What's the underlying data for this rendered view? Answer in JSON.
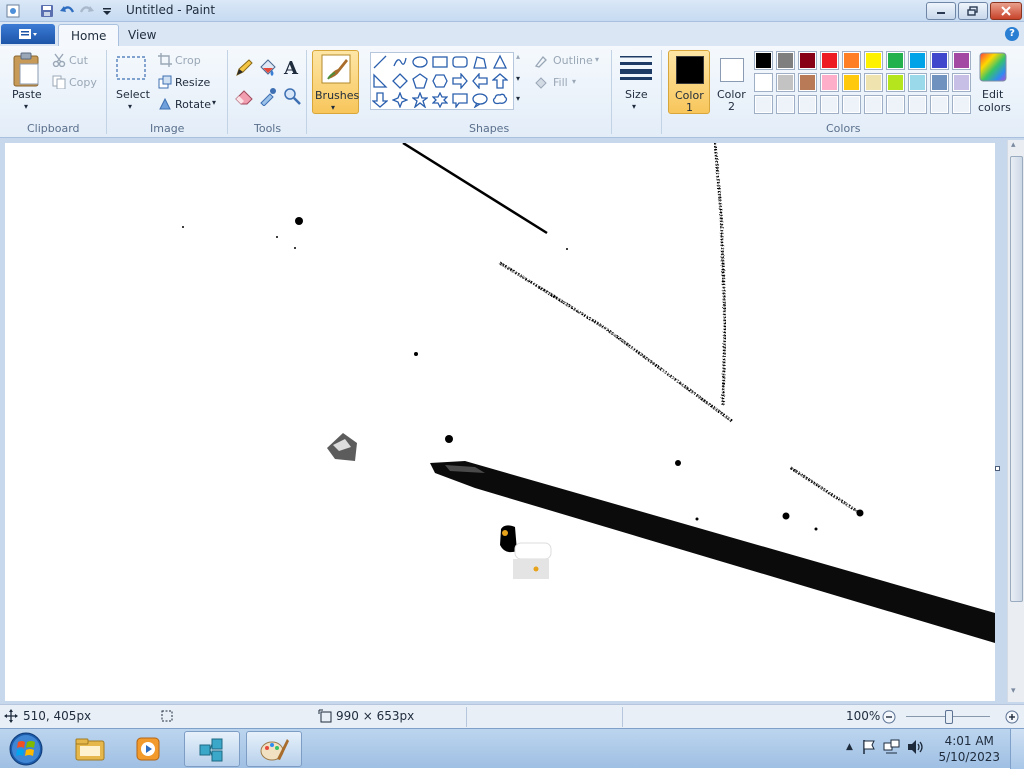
{
  "window": {
    "title": "Untitled - Paint"
  },
  "tabs": {
    "home": "Home",
    "view": "View"
  },
  "clipboard": {
    "paste": "Paste",
    "cut": "Cut",
    "copy": "Copy",
    "group": "Clipboard"
  },
  "image": {
    "select": "Select",
    "crop": "Crop",
    "resize": "Resize",
    "rotate": "Rotate",
    "group": "Image"
  },
  "tools": {
    "group": "Tools"
  },
  "brushes": {
    "label": "Brushes"
  },
  "shapes": {
    "outline": "Outline",
    "fill": "Fill",
    "group": "Shapes"
  },
  "size": {
    "label": "Size"
  },
  "colors": {
    "color1_line1": "Color",
    "color1_line2": "1",
    "color1_value": "#000000",
    "color2_line1": "Color",
    "color2_line2": "2",
    "color2_value": "#ffffff",
    "edit_line1": "Edit",
    "edit_line2": "colors",
    "group": "Colors",
    "palette_row1": [
      "#000000",
      "#7f7f7f",
      "#880015",
      "#ed1c24",
      "#ff7f27",
      "#fff200",
      "#22b14c",
      "#00a2e8",
      "#3f48cc",
      "#a349a4"
    ],
    "palette_row2": [
      "#ffffff",
      "#c3c3c3",
      "#b97a57",
      "#ffaec9",
      "#ffc90e",
      "#efe4b0",
      "#b5e61d",
      "#99d9ea",
      "#7092be",
      "#c8bfe7"
    ]
  },
  "status": {
    "cursor_pos": "510, 405px",
    "canvas_size": "990 × 653px",
    "zoom": "100%"
  },
  "taskbar": {
    "time": "4:01 AM",
    "date": "5/10/2023"
  },
  "icons": [
    "app-icon",
    "save-icon",
    "undo-icon",
    "redo-icon",
    "customize-icon",
    "help-icon",
    "paste-icon",
    "cut-icon",
    "copy-icon",
    "select-icon",
    "crop-icon",
    "resize-icon",
    "rotate-icon",
    "pencil-icon",
    "fill-icon",
    "text-icon",
    "eraser-icon",
    "color-picker-icon",
    "magnifier-icon",
    "brush-icon",
    "size-icon",
    "edit-colors-icon",
    "start-icon",
    "explorer-icon",
    "media-player-icon",
    "network-icon",
    "paint-icon",
    "flag-icon",
    "volume-icon"
  ]
}
